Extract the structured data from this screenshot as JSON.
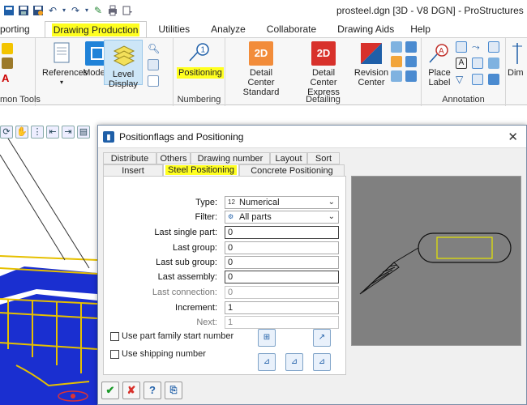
{
  "window": {
    "title": "prosteel.dgn [3D - V8 DGN] - ProStructures"
  },
  "quick_access": {
    "icons": [
      "app-icon",
      "save-icon",
      "save-settings-icon",
      "undo-icon",
      "undo-dropdown-icon",
      "redo-icon",
      "redo-dropdown-icon",
      "pin-icon",
      "print-icon",
      "customize-icon"
    ]
  },
  "ribbon_tabs": [
    {
      "label": "porting"
    },
    {
      "label": "Drawing Production",
      "active": true
    },
    {
      "label": "Utilities"
    },
    {
      "label": "Analyze"
    },
    {
      "label": "Collaborate"
    },
    {
      "label": "Drawing Aids"
    },
    {
      "label": "Help"
    }
  ],
  "ribbon": {
    "groups": [
      {
        "label": "mon Tools"
      },
      {
        "label": "Numbering"
      },
      {
        "label": "Detailing"
      },
      {
        "label": "Annotation"
      }
    ],
    "buttons": {
      "references": "References",
      "models": "Models",
      "level_display_line1": "Level",
      "level_display_line2": "Display",
      "positioning": "Positioning",
      "detail_center_standard_line1": "Detail",
      "detail_center_standard_line2": "Center Standard",
      "detail_center_express_line1": "Detail",
      "detail_center_express_line2": "Center Express",
      "revision_center_line1": "Revision",
      "revision_center_line2": "Center",
      "place_label_line1": "Place",
      "place_label_line2": "Label",
      "dim": "Dim",
      "badge_2d": "2D"
    },
    "colors": {
      "highlight": "#ffff20",
      "active_button": "#cde6f7",
      "accent_blue": "#1f5fa8"
    }
  },
  "dialog": {
    "title": "Positionflags and Positioning",
    "tabs_row1": [
      "Distribute",
      "Others",
      "Drawing number",
      "Layout",
      "Sort"
    ],
    "tabs_row2": [
      "Insert",
      "Steel Positioning",
      "Concrete Positioning"
    ],
    "active_tab": "Steel Positioning",
    "fields": {
      "type": {
        "label": "Type:",
        "value": "Numerical",
        "icon_text": "12"
      },
      "filter": {
        "label": "Filter:",
        "value": "All parts"
      },
      "last_single_part": {
        "label": "Last single part:",
        "value": "0"
      },
      "last_group": {
        "label": "Last group:",
        "value": "0"
      },
      "last_sub_group": {
        "label": "Last sub group:",
        "value": "0"
      },
      "last_assembly": {
        "label": "Last assembly:",
        "value": "0"
      },
      "last_connection": {
        "label": "Last connection:",
        "value": "0"
      },
      "increment": {
        "label": "Increment:",
        "value": "1"
      },
      "next": {
        "label": "Next:",
        "value": "1"
      }
    },
    "checkboxes": [
      {
        "label": "Use part family start number",
        "checked": false
      },
      {
        "label": "Use shipping number",
        "checked": false
      }
    ],
    "bottom_buttons": [
      "ok-icon",
      "cancel-icon",
      "help-icon",
      "export-icon"
    ],
    "preview_bg": "#808080",
    "preview_rect_color": "#e6e600"
  }
}
